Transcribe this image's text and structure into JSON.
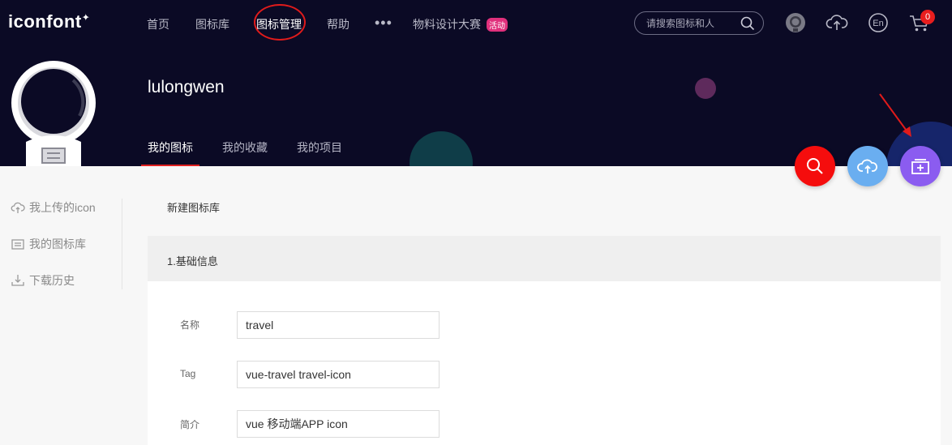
{
  "header": {
    "logo": "iconfont",
    "logo_mark": "✦",
    "nav": [
      {
        "label": "首页"
      },
      {
        "label": "图标库"
      },
      {
        "label": "图标管理"
      },
      {
        "label": "帮助"
      },
      {
        "label": "物料设计大赛"
      }
    ],
    "more": "•••",
    "event_badge": "活动",
    "search": {
      "placeholder": "请搜索图标和人"
    },
    "cart_count": "0",
    "lang_label": "En"
  },
  "profile": {
    "username": "lulongwen",
    "tabs": [
      {
        "label": "我的图标"
      },
      {
        "label": "我的收藏"
      },
      {
        "label": "我的项目"
      }
    ]
  },
  "fab": {
    "search_color": "#f50d0d",
    "upload_color": "#6aaef0",
    "new_color": "#8b5cf0"
  },
  "sidebar": {
    "items": [
      {
        "label": "我上传的icon",
        "icon": "cloud-upload-icon"
      },
      {
        "label": "我的图标库",
        "icon": "library-icon"
      },
      {
        "label": "下载历史",
        "icon": "download-icon"
      }
    ]
  },
  "main": {
    "page_title": "新建图标库",
    "section_title": "1.基础信息",
    "fields": [
      {
        "label": "名称",
        "value": "travel"
      },
      {
        "label": "Tag",
        "value": "vue-travel travel-icon"
      },
      {
        "label": "简介",
        "value": "vue 移动端APP icon"
      }
    ]
  },
  "colors": {
    "header_bg": "#0b0a25",
    "accent_red": "#e02020"
  }
}
